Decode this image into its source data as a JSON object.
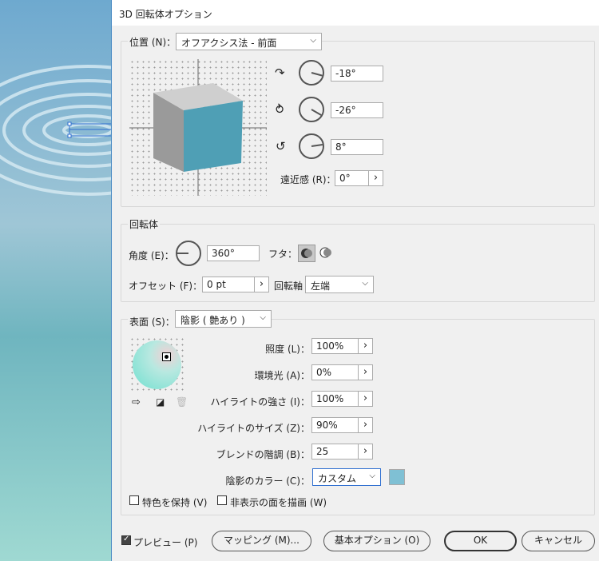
{
  "dialog": {
    "title": "3D 回転体オプション"
  },
  "position": {
    "label": "位置 (N)：",
    "preset": "オフアクシス法 - 前面",
    "rot_x": "-18°",
    "rot_y": "-26°",
    "rot_z": "8°",
    "perspective_label": "遠近感 (R)：",
    "perspective": "0°"
  },
  "revolve": {
    "group_label": "回転体",
    "angle_label": "角度 (E)：",
    "angle": "360°",
    "cap_label": "フタ：",
    "offset_label": "オフセット (F)：",
    "offset": "0 pt",
    "axis_label": "回転軸",
    "axis": "左端"
  },
  "surface": {
    "label": "表面 (S)：",
    "value": "陰影 ( 艶あり )",
    "light_intensity_label": "照度 (L)：",
    "light_intensity": "100%",
    "ambient_label": "環境光 (A)：",
    "ambient": "0%",
    "highlight_intensity_label": "ハイライトの強さ (I)：",
    "highlight_intensity": "100%",
    "highlight_size_label": "ハイライトのサイズ (Z)：",
    "highlight_size": "90%",
    "blend_steps_label": "ブレンドの階調 (B)：",
    "blend_steps": "25",
    "shading_color_label": "陰影のカラー (C)：",
    "shading_color": "カスタム",
    "shading_swatch": "#7fc0d4",
    "preserve_spot_label": "特色を保持 (V)",
    "draw_hidden_label": "非表示の面を描画 (W)"
  },
  "footer": {
    "preview_label": "プレビュー (P)",
    "mapping_label": "マッピング (M)...",
    "basic_options_label": "基本オプション (O)",
    "ok_label": "OK",
    "cancel_label": "キャンセル"
  },
  "colors": {
    "cube_front": "#4f9fb5",
    "cube_side": "#9a9a9a",
    "cube_top": "#cfcfcf"
  }
}
